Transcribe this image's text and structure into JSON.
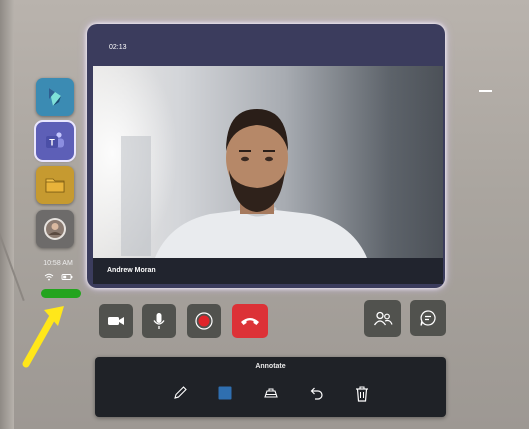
{
  "rail": {
    "apps": [
      {
        "name": "dynamics-guides",
        "icon": "dynamics-icon"
      },
      {
        "name": "teams",
        "icon": "teams-icon",
        "active": true
      },
      {
        "name": "files",
        "icon": "folder-icon"
      },
      {
        "name": "profile",
        "icon": "avatar-icon"
      }
    ],
    "time": "10:58 AM",
    "status_icons": [
      "wifi-icon",
      "battery-icon"
    ],
    "indicator_color": "#23a41e"
  },
  "call": {
    "timer": "02:13",
    "caller_name": "Andrew Moran"
  },
  "controls": [
    "camera-icon",
    "microphone-icon",
    "record-icon",
    "hang-up-icon",
    "participants-icon",
    "chat-icon"
  ],
  "annotate": {
    "title": "Annotate",
    "tools": [
      "pen-icon",
      "color-swatch",
      "eraser-icon",
      "undo-icon",
      "trash-icon"
    ],
    "selected_color": "#2f6fb0"
  },
  "colors": {
    "end_call": "#dc3237",
    "record": "#e0242a",
    "window_glow": "#d8c8ff"
  }
}
